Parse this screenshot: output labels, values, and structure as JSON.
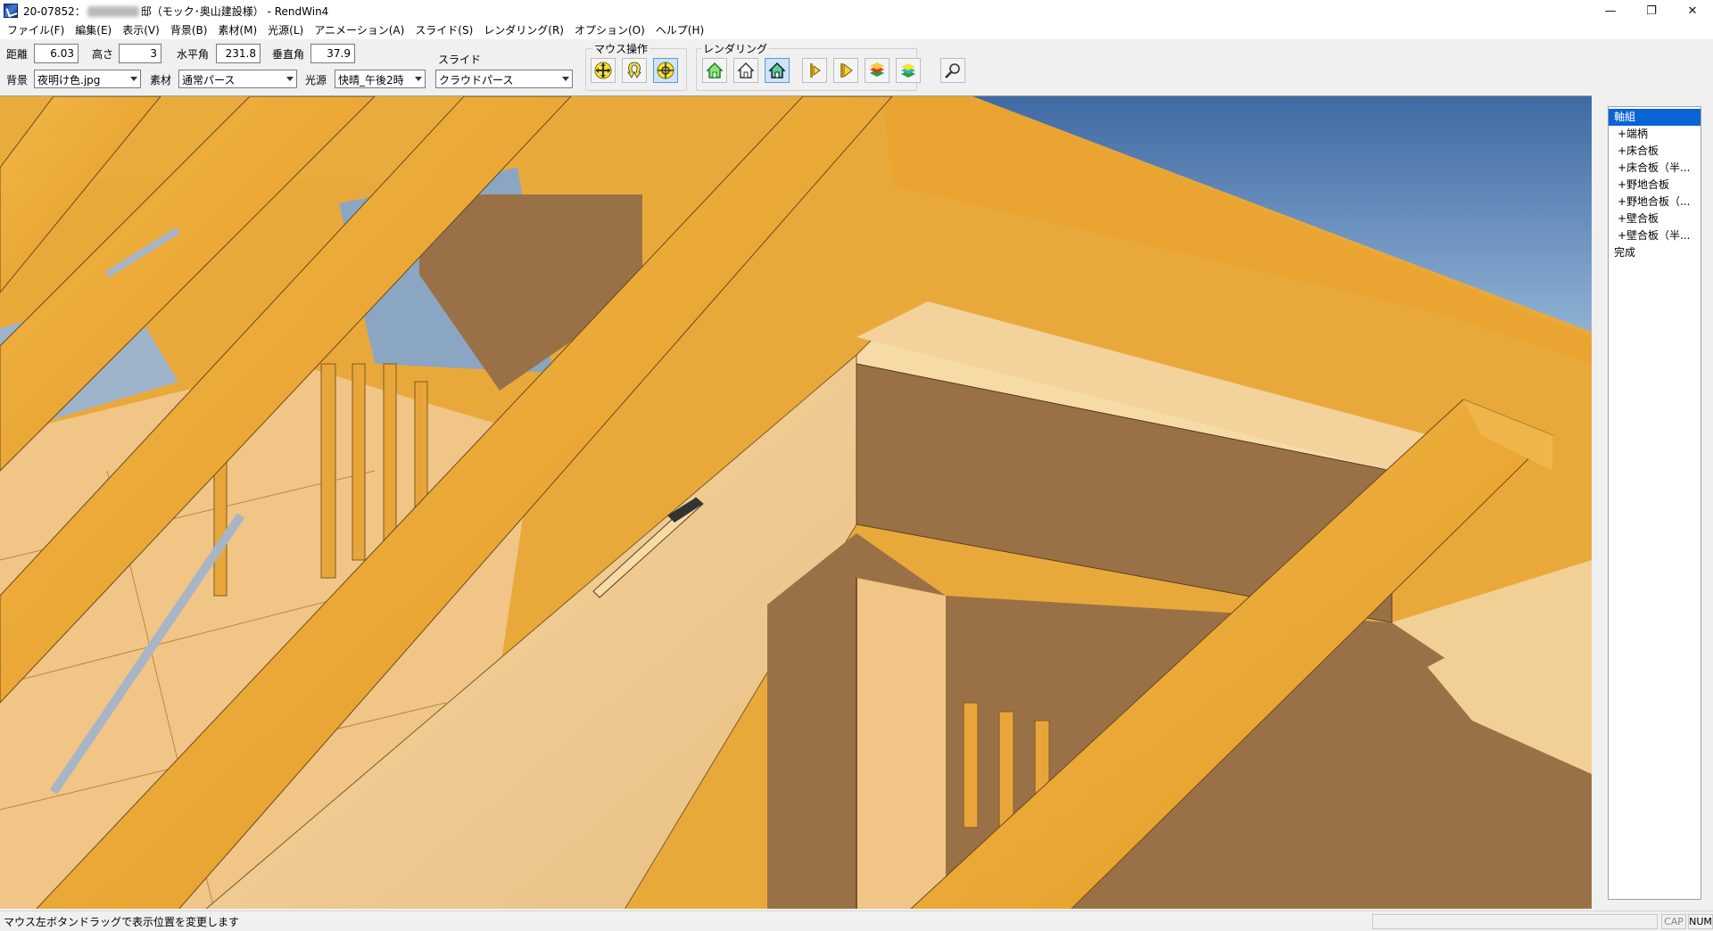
{
  "window": {
    "title_prefix": "20-07852：",
    "title_suffix": "邸（モック･奥山建設様） - RendWin4",
    "minimize": "—",
    "restore": "❐",
    "close": "✕"
  },
  "menu": [
    "ファイル(F)",
    "編集(E)",
    "表示(V)",
    "背景(B)",
    "素材(M)",
    "光源(L)",
    "アニメーション(A)",
    "スライド(S)",
    "レンダリング(R)",
    "オプション(O)",
    "ヘルプ(H)"
  ],
  "toolbar": {
    "distance_label": "距離",
    "distance_value": "6.03",
    "height_label": "高さ",
    "height_value": "3",
    "horizontal_label": "水平角",
    "horizontal_value": "231.8",
    "vertical_label": "垂直角",
    "vertical_value": "37.9",
    "background_label": "背景",
    "background_value": "夜明け色.jpg",
    "material_label": "素材",
    "material_value": "通常パース",
    "light_label": "光源",
    "light_value": "快晴_午後2時",
    "slide_label": "スライド",
    "slide_value": "クラウドパース",
    "mouse_group_label": "マウス操作",
    "render_group_label": "レンダリング"
  },
  "tree": {
    "items": [
      {
        "label": "軸組",
        "selected": true,
        "child": false
      },
      {
        "label": "+端柄",
        "selected": false,
        "child": true
      },
      {
        "label": "+床合板",
        "selected": false,
        "child": true
      },
      {
        "label": "+床合板（半...",
        "selected": false,
        "child": true
      },
      {
        "label": "+野地合板",
        "selected": false,
        "child": true
      },
      {
        "label": "+野地合板（...",
        "selected": false,
        "child": true
      },
      {
        "label": "+壁合板",
        "selected": false,
        "child": true
      },
      {
        "label": "+壁合板（半...",
        "selected": false,
        "child": true
      },
      {
        "label": "完成",
        "selected": false,
        "child": false
      }
    ]
  },
  "status": {
    "message": "マウス左ボタンドラッグで表示位置を変更します",
    "cap": "CAP",
    "num": "NUM"
  },
  "colors": {
    "selection": "#0a64d8",
    "wood_orange": "#e9a93a",
    "wood_light": "#f2cf95",
    "wood_shadow": "#9a7147",
    "sky": "#5a7fa6"
  }
}
